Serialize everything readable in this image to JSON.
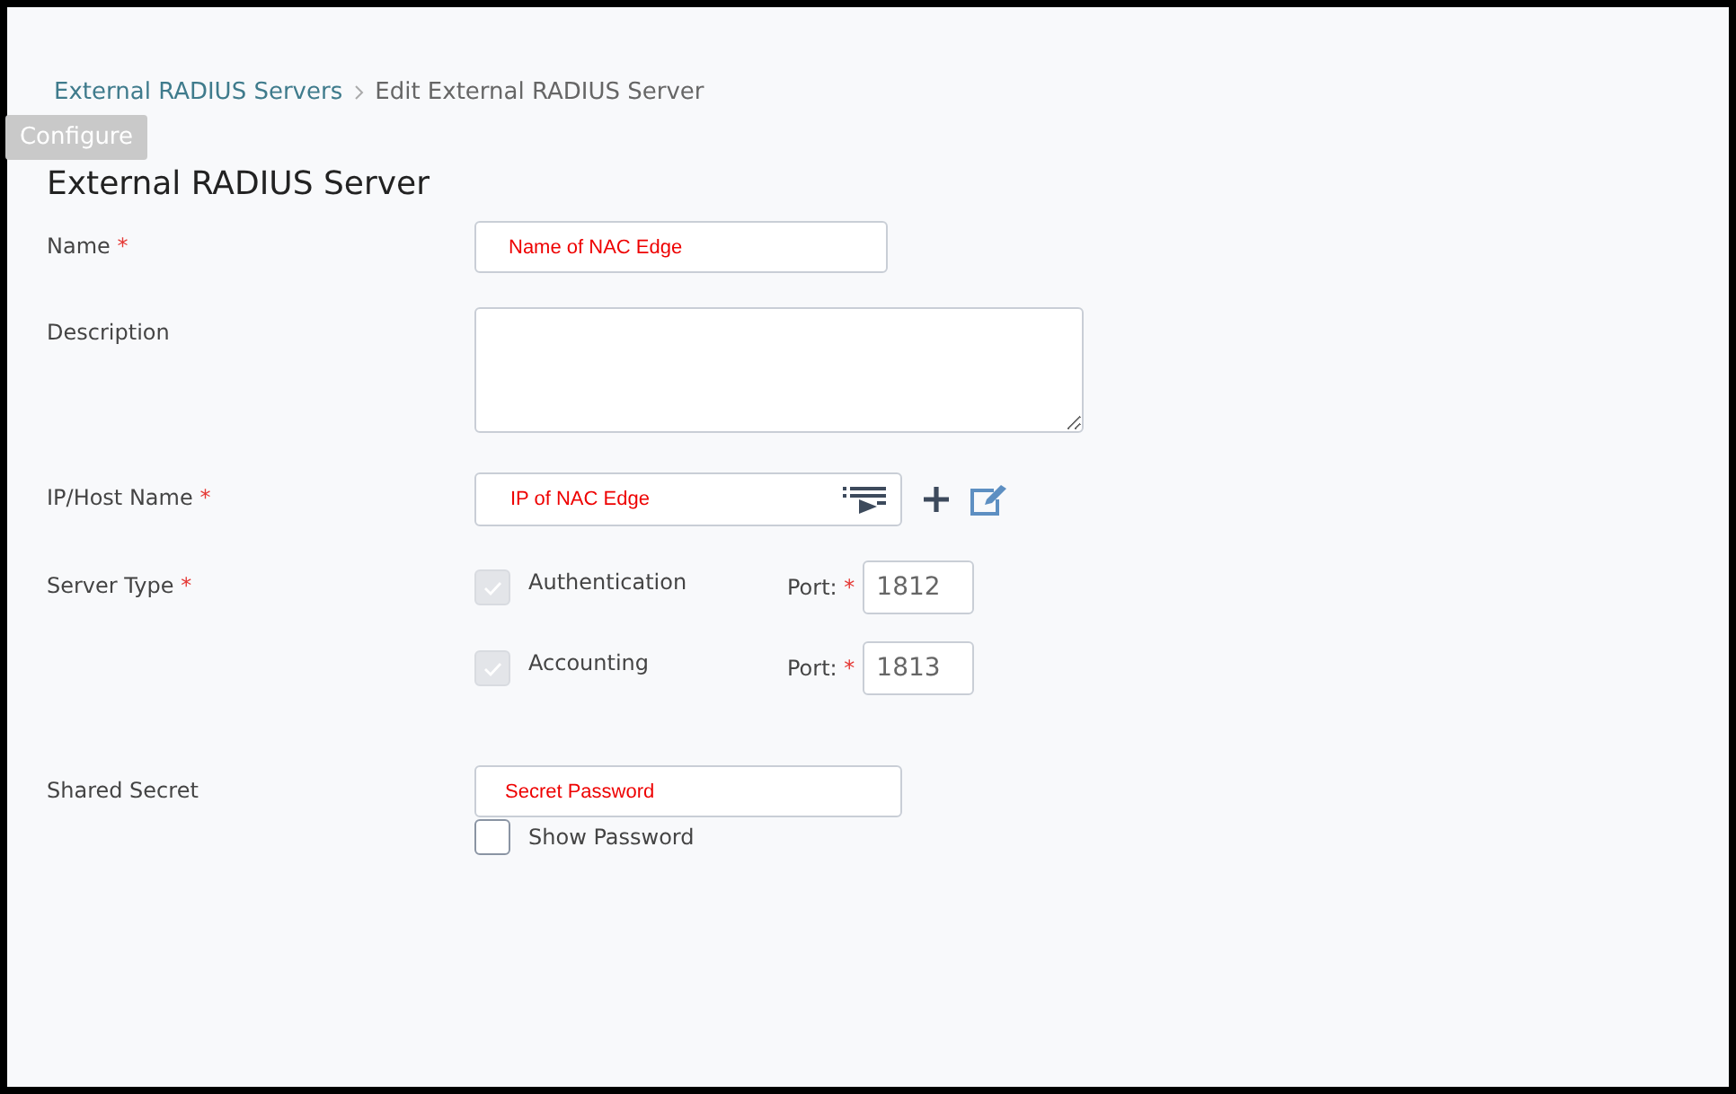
{
  "breadcrumb": [
    {
      "label": "External RADIUS Servers",
      "kind": "link"
    },
    {
      "label": "Edit External RADIUS Server",
      "kind": "current"
    }
  ],
  "configure_tab": {
    "label": "Configure"
  },
  "title": "External RADIUS Server",
  "fields": [
    {
      "kind": "text",
      "label": "Name",
      "required_mark": "*",
      "value": "Name of NAC Edge"
    },
    {
      "kind": "textarea",
      "label": "Description"
    },
    {
      "kind": "select",
      "label": "IP/Host Name",
      "required_mark": "*",
      "value": "IP of NAC Edge"
    },
    {
      "kind": "server_type",
      "label": "Server Type",
      "required_mark": "*",
      "options": [
        {
          "label": "Authentication",
          "checked": true,
          "disabled": true,
          "port_label": "Port:",
          "port_required_mark": "*",
          "port": "1812"
        },
        {
          "label": "Accounting",
          "checked": true,
          "disabled": true,
          "port_label": "Port:",
          "port_required_mark": "*",
          "port": "1813"
        }
      ]
    },
    {
      "kind": "password",
      "label": "Shared Secret",
      "value": "Secret Password",
      "show_password": {
        "label": "Show Password",
        "checked": false
      }
    }
  ]
}
